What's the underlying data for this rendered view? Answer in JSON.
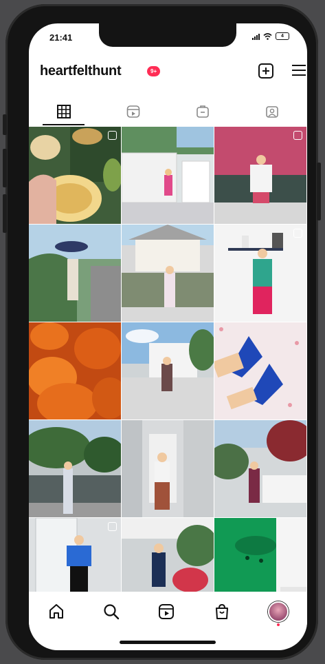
{
  "status_bar": {
    "time": "21:41",
    "battery": "4"
  },
  "profile": {
    "username": "heartfelthunt",
    "notification_badge": "9+"
  },
  "tabs": [
    {
      "name": "posts-grid",
      "icon": "grid-icon",
      "active": true
    },
    {
      "name": "reels",
      "icon": "reels-icon",
      "active": false
    },
    {
      "name": "guides",
      "icon": "guides-icon",
      "active": false
    },
    {
      "name": "tagged",
      "icon": "tagged-icon",
      "active": false
    }
  ],
  "posts": [
    {
      "scene": "croissant-coffee",
      "reel": true
    },
    {
      "scene": "white-gate",
      "reel": false
    },
    {
      "scene": "red-ivy-wall",
      "reel": true
    },
    {
      "scene": "street-umbrella",
      "reel": false
    },
    {
      "scene": "house-fence",
      "reel": false
    },
    {
      "scene": "shelf-wall",
      "reel": true
    },
    {
      "scene": "pumpkins",
      "reel": false
    },
    {
      "scene": "white-villa",
      "reel": false
    },
    {
      "scene": "blue-heels",
      "reel": false
    },
    {
      "scene": "trees-fence",
      "reel": false
    },
    {
      "scene": "building-door",
      "reel": false
    },
    {
      "scene": "red-tree-fence",
      "reel": false
    },
    {
      "scene": "glass-door",
      "reel": true
    },
    {
      "scene": "garden-path",
      "reel": false
    },
    {
      "scene": "green-sweater",
      "reel": false
    }
  ],
  "bottom_nav": [
    {
      "name": "home",
      "icon": "home-icon"
    },
    {
      "name": "search",
      "icon": "search-icon"
    },
    {
      "name": "reels",
      "icon": "reels-icon"
    },
    {
      "name": "shop",
      "icon": "shop-icon"
    },
    {
      "name": "profile",
      "icon": "avatar"
    }
  ]
}
